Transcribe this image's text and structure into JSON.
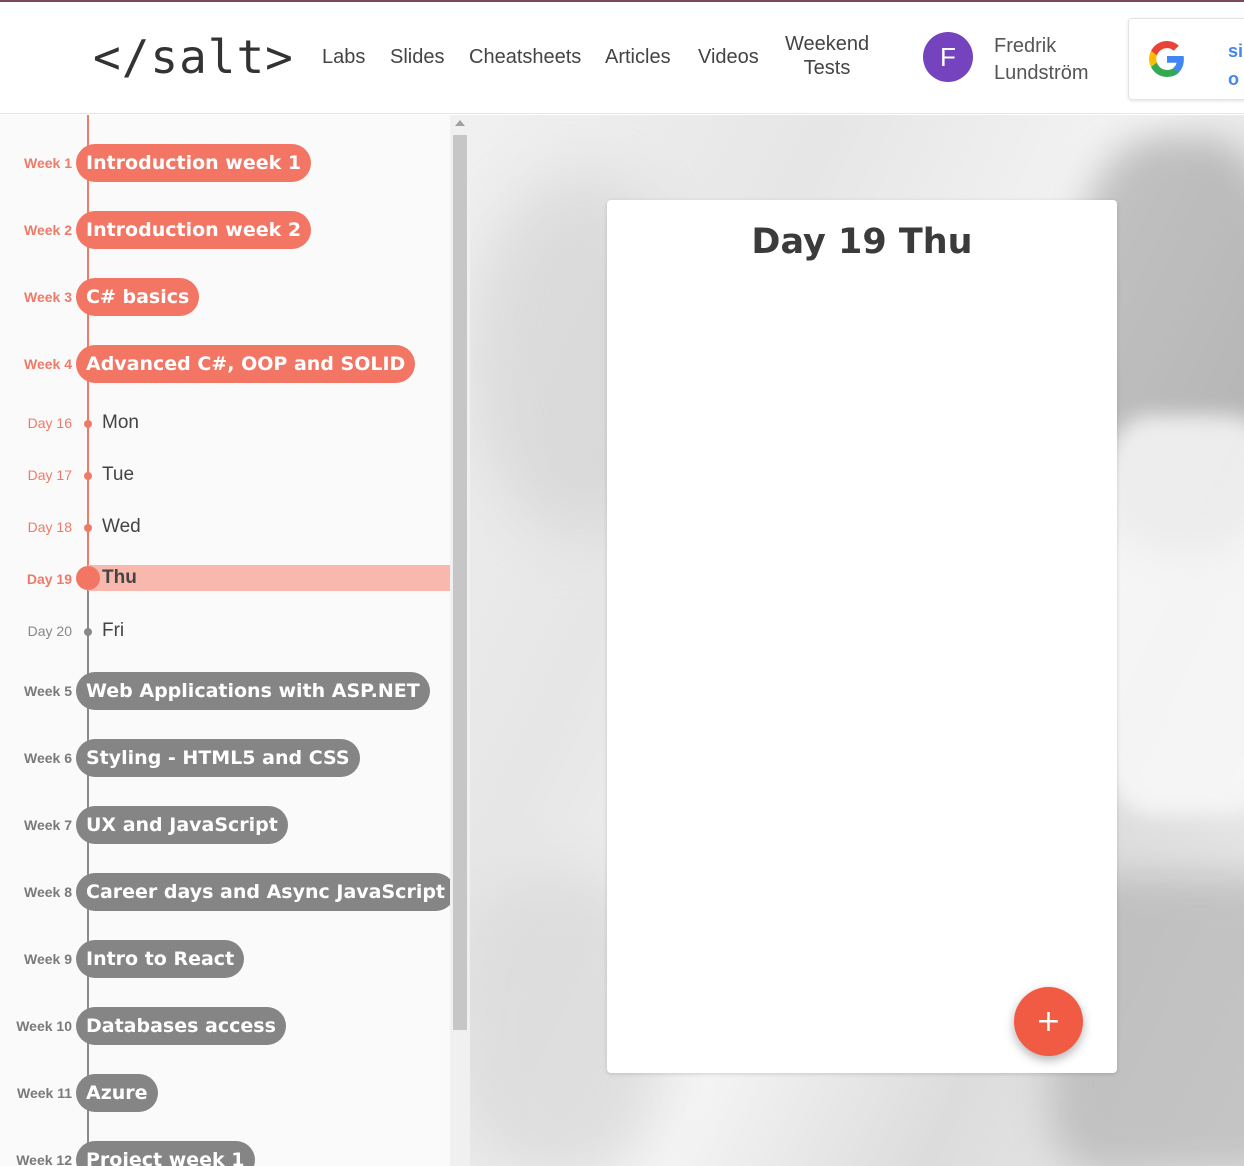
{
  "nav": {
    "logo": "</salt>",
    "links": [
      "Labs",
      "Slides",
      "Cheatsheets",
      "Articles",
      "Videos"
    ],
    "weekend_line1": "Weekend",
    "weekend_line2": "Tests",
    "avatar_letter": "F",
    "user_first": "Fredrik",
    "user_last": "Lundström",
    "google_line1": "si",
    "google_line2": "o"
  },
  "sidebar": {
    "weeks_done": [
      {
        "week": "Week 1",
        "title": "Introduction week 1"
      },
      {
        "week": "Week 2",
        "title": "Introduction week 2"
      },
      {
        "week": "Week 3",
        "title": "C# basics"
      },
      {
        "week": "Week 4",
        "title": "Advanced C#, OOP and SOLID"
      }
    ],
    "days": [
      {
        "day": "Day 16",
        "name": "Mon"
      },
      {
        "day": "Day 17",
        "name": "Tue"
      },
      {
        "day": "Day 18",
        "name": "Wed"
      },
      {
        "day": "Day 19",
        "name": "Thu"
      },
      {
        "day": "Day 20",
        "name": "Fri"
      }
    ],
    "weeks_todo": [
      {
        "week": "Week 5",
        "title": "Web Applications with ASP.NET"
      },
      {
        "week": "Week 6",
        "title": "Styling - HTML5 and CSS"
      },
      {
        "week": "Week 7",
        "title": "UX and JavaScript"
      },
      {
        "week": "Week 8",
        "title": "Career days and Async JavaScript"
      },
      {
        "week": "Week 9",
        "title": "Intro to React"
      },
      {
        "week": "Week 10",
        "title": "Databases access"
      },
      {
        "week": "Week 11",
        "title": "Azure"
      },
      {
        "week": "Week 12",
        "title": "Project week 1"
      }
    ]
  },
  "card": {
    "title": "Day 19 Thu",
    "fab_label": "+"
  },
  "colors": {
    "accent": "#f37563",
    "inactive": "#858585",
    "avatar": "#7443bd",
    "fab": "#f15a43"
  }
}
